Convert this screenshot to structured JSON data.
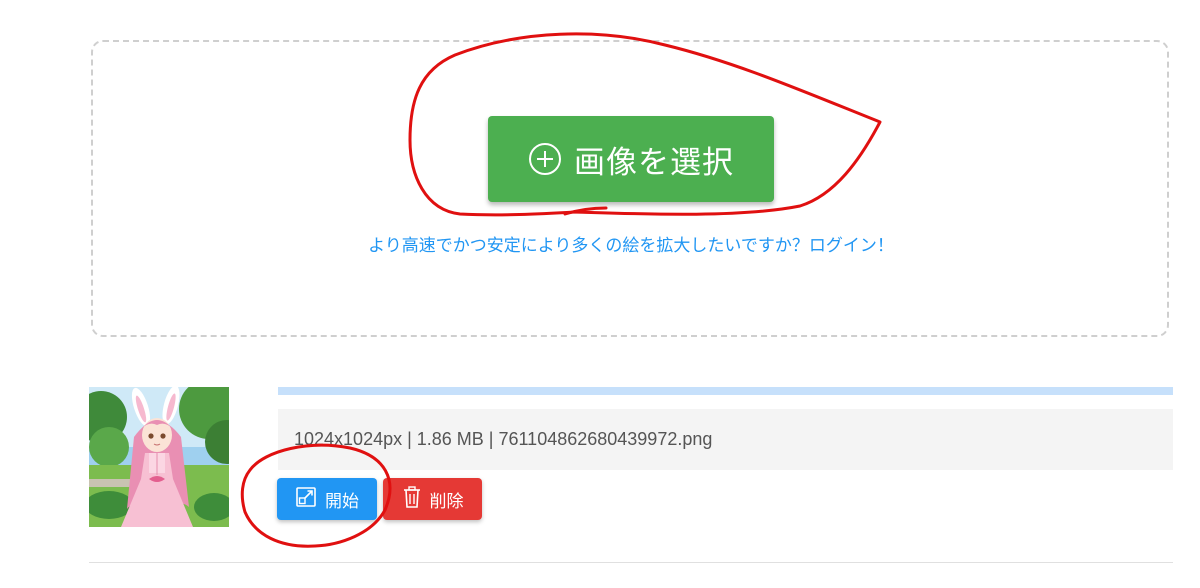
{
  "uploader": {
    "select_button_label": "画像を選択",
    "login_hint": "より高速でかつ安定により多くの絵を拡大したいですか？ログイン！"
  },
  "file": {
    "info": "1024x1024px | 1.86 MB | 761104862680439972.png",
    "progress": 1.0,
    "start_label": "開始",
    "delete_label": "削除"
  },
  "colors": {
    "select_button": "#4caf50",
    "start_button": "#2196f3",
    "delete_button": "#e53935",
    "link": "#2196f3",
    "annotation": "#e01010"
  },
  "icons": {
    "select": "plus-circle-icon",
    "start": "open-external-icon",
    "delete": "trash-icon"
  }
}
